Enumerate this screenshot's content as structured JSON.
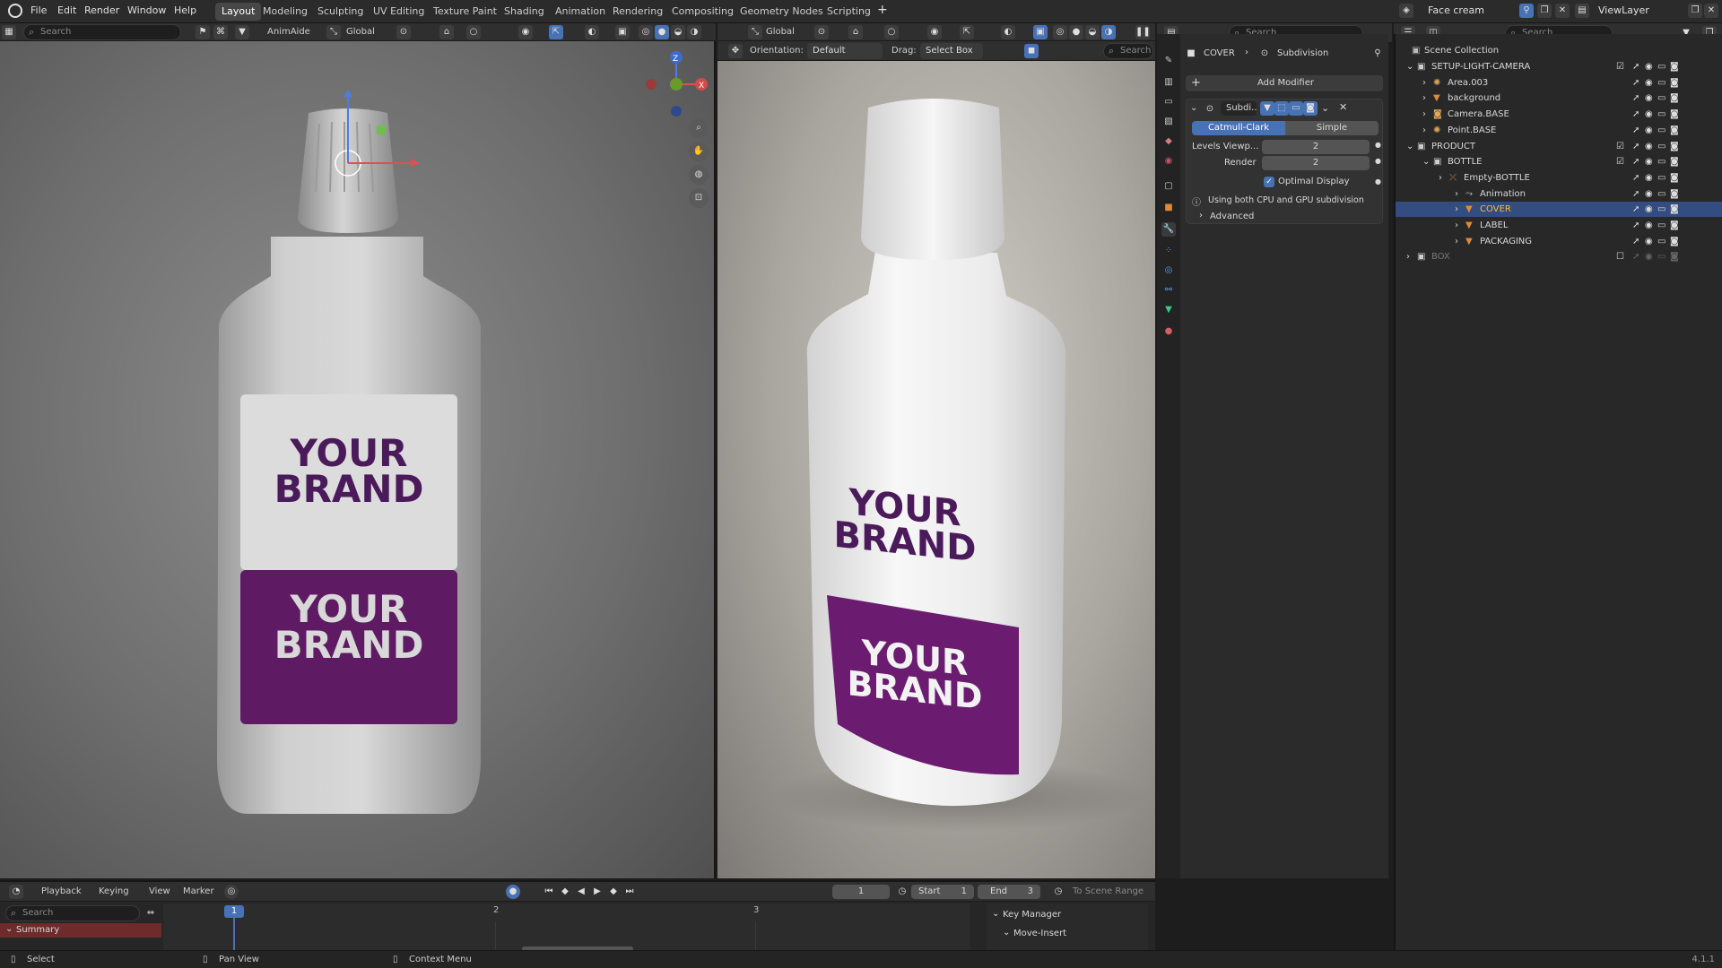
{
  "app": {
    "version": "4.1.1"
  },
  "menu": [
    "File",
    "Edit",
    "Render",
    "Window",
    "Help"
  ],
  "workspaces": [
    "Layout",
    "Modeling",
    "Sculpting",
    "UV Editing",
    "Texture Paint",
    "Shading",
    "Animation",
    "Rendering",
    "Compositing",
    "Geometry Nodes",
    "Scripting"
  ],
  "active_workspace": "Layout",
  "scene": {
    "name": "Face cream",
    "view_layer": "ViewLayer"
  },
  "viewport_left": {
    "search_placeholder": "Search",
    "addon": "AnimAide",
    "transform": "Global",
    "label_top": "YOUR\nBRAND",
    "label_bottom": "YOUR\nBRAND"
  },
  "viewport_right": {
    "transform": "Global",
    "orientation_label": "Orientation:",
    "orientation_value": "Default",
    "drag_label": "Drag:",
    "drag_value": "Select Box",
    "search_placeholder": "Search",
    "label_top": "YOUR\nBRAND",
    "label_bottom": "YOUR\nBRAND"
  },
  "properties": {
    "search_placeholder": "Search",
    "breadcrumb_object": "COVER",
    "breadcrumb_modifier": "Subdivision",
    "add_modifier": "Add Modifier",
    "modifier_name": "Subdi...",
    "algo_catmull": "Catmull-Clark",
    "algo_simple": "Simple",
    "levels_label": "Levels Viewp...",
    "levels_value": "2",
    "render_label": "Render",
    "render_value": "2",
    "optimal_label": "Optimal Display",
    "info_text": "Using both CPU and GPU subdivision",
    "advanced": "Advanced"
  },
  "outliner": {
    "search_placeholder": "Search",
    "root": "Scene Collection",
    "items": [
      {
        "label": "SETUP-LIGHT-CAMERA",
        "indent": 1,
        "icon": "collection-icon"
      },
      {
        "label": "Area.003",
        "indent": 2,
        "icon": "light-icon"
      },
      {
        "label": "background",
        "indent": 2,
        "icon": "mesh-icon"
      },
      {
        "label": "Camera.BASE",
        "indent": 2,
        "icon": "camera-icon"
      },
      {
        "label": "Point.BASE",
        "indent": 2,
        "icon": "light-icon"
      },
      {
        "label": "PRODUCT",
        "indent": 1,
        "icon": "collection-icon"
      },
      {
        "label": "BOTTLE",
        "indent": 2,
        "icon": "collection-icon"
      },
      {
        "label": "Empty-BOTTLE",
        "indent": 3,
        "icon": "empty-icon"
      },
      {
        "label": "Animation",
        "indent": 4,
        "icon": "action-icon"
      },
      {
        "label": "COVER",
        "indent": 4,
        "icon": "mesh-icon",
        "selected": true
      },
      {
        "label": "LABEL",
        "indent": 4,
        "icon": "mesh-icon"
      },
      {
        "label": "PACKAGING",
        "indent": 4,
        "icon": "mesh-icon"
      },
      {
        "label": "BOX",
        "indent": 1,
        "icon": "collection-icon",
        "disabled": true
      }
    ]
  },
  "timeline": {
    "menu": [
      "Playback",
      "Keying",
      "View",
      "Marker"
    ],
    "current_frame": "1",
    "start_label": "Start",
    "start_value": "1",
    "end_label": "End",
    "end_value": "3",
    "range_label": "To Scene Range",
    "search_placeholder": "Search",
    "summary": "Summary",
    "ruler": [
      "1",
      "2",
      "3"
    ],
    "key_manager": "Key Manager",
    "move_insert": "Move-Insert"
  },
  "status": {
    "select": "Select",
    "pan": "Pan View",
    "context": "Context Menu"
  },
  "colors": {
    "accent": "#4772b3",
    "brand_purple": "#6a1b6e",
    "selection": "#334d80"
  }
}
